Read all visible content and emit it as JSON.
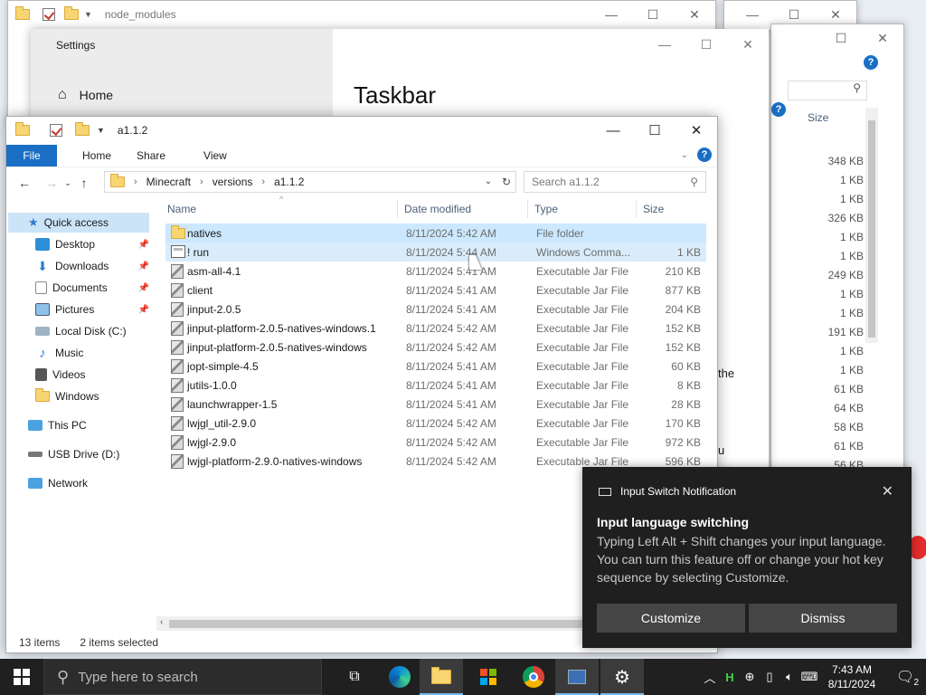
{
  "bg_windows": {
    "top_title": "node_modules"
  },
  "settings": {
    "title": "Settings",
    "home_label": "Home",
    "heading": "Taskbar",
    "fragment_1": "the",
    "fragment_2": "u"
  },
  "explorer": {
    "title": "a1.1.2",
    "ribbon": {
      "file": "File",
      "home": "Home",
      "share": "Share",
      "view": "View"
    },
    "breadcrumb": [
      "Minecraft",
      "versions",
      "a1.1.2"
    ],
    "search_placeholder": "Search a1.1.2",
    "columns": {
      "name": "Name",
      "date": "Date modified",
      "type": "Type",
      "size": "Size"
    },
    "nav": {
      "quick_access": "Quick access",
      "desktop": "Desktop",
      "downloads": "Downloads",
      "documents": "Documents",
      "pictures": "Pictures",
      "local_disk": "Local Disk (C:)",
      "music": "Music",
      "videos": "Videos",
      "windows": "Windows",
      "this_pc": "This PC",
      "usb": "USB Drive (D:)",
      "network": "Network"
    },
    "files": [
      {
        "name": "natives",
        "date": "8/11/2024 5:42 AM",
        "type": "File folder",
        "size": ""
      },
      {
        "name": "! run",
        "date": "8/11/2024 5:44 AM",
        "type": "Windows Comma...",
        "size": "1 KB"
      },
      {
        "name": "asm-all-4.1",
        "date": "8/11/2024 5:41 AM",
        "type": "Executable Jar File",
        "size": "210 KB"
      },
      {
        "name": "client",
        "date": "8/11/2024 5:41 AM",
        "type": "Executable Jar File",
        "size": "877 KB"
      },
      {
        "name": "jinput-2.0.5",
        "date": "8/11/2024 5:41 AM",
        "type": "Executable Jar File",
        "size": "204 KB"
      },
      {
        "name": "jinput-platform-2.0.5-natives-windows.1",
        "date": "8/11/2024 5:42 AM",
        "type": "Executable Jar File",
        "size": "152 KB"
      },
      {
        "name": "jinput-platform-2.0.5-natives-windows",
        "date": "8/11/2024 5:42 AM",
        "type": "Executable Jar File",
        "size": "152 KB"
      },
      {
        "name": "jopt-simple-4.5",
        "date": "8/11/2024 5:41 AM",
        "type": "Executable Jar File",
        "size": "60 KB"
      },
      {
        "name": "jutils-1.0.0",
        "date": "8/11/2024 5:41 AM",
        "type": "Executable Jar File",
        "size": "8 KB"
      },
      {
        "name": "launchwrapper-1.5",
        "date": "8/11/2024 5:41 AM",
        "type": "Executable Jar File",
        "size": "28 KB"
      },
      {
        "name": "lwjgl_util-2.9.0",
        "date": "8/11/2024 5:42 AM",
        "type": "Executable Jar File",
        "size": "170 KB"
      },
      {
        "name": "lwjgl-2.9.0",
        "date": "8/11/2024 5:42 AM",
        "type": "Executable Jar File",
        "size": "972 KB"
      },
      {
        "name": "lwjgl-platform-2.9.0-natives-windows",
        "date": "8/11/2024 5:42 AM",
        "type": "Executable Jar File",
        "size": "596 KB"
      }
    ],
    "status_count": "13 items",
    "status_selected": "2 items selected"
  },
  "bg_sizes": {
    "header": "Size",
    "values": [
      "348 KB",
      "1 KB",
      "1 KB",
      "326 KB",
      "1 KB",
      "1 KB",
      "249 KB",
      "1 KB",
      "1 KB",
      "191 KB",
      "1 KB",
      "1 KB",
      "61 KB",
      "64 KB",
      "58 KB",
      "61 KB",
      "56 KB"
    ]
  },
  "toast": {
    "header": "Input Switch Notification",
    "title": "Input language switching",
    "body": "Typing Left Alt + Shift changes your input language. You can turn this feature off or change your hot key sequence by selecting Customize.",
    "customize": "Customize",
    "dismiss": "Dismiss"
  },
  "taskbar": {
    "search_placeholder": "Type here to search",
    "time": "7:43 AM",
    "date": "8/11/2024",
    "notification_count": "2"
  },
  "colors": {
    "accent": "#1a6fc4",
    "selection": "#cce8ff",
    "taskbar": "#202020",
    "toast": "#1f1f1f"
  }
}
